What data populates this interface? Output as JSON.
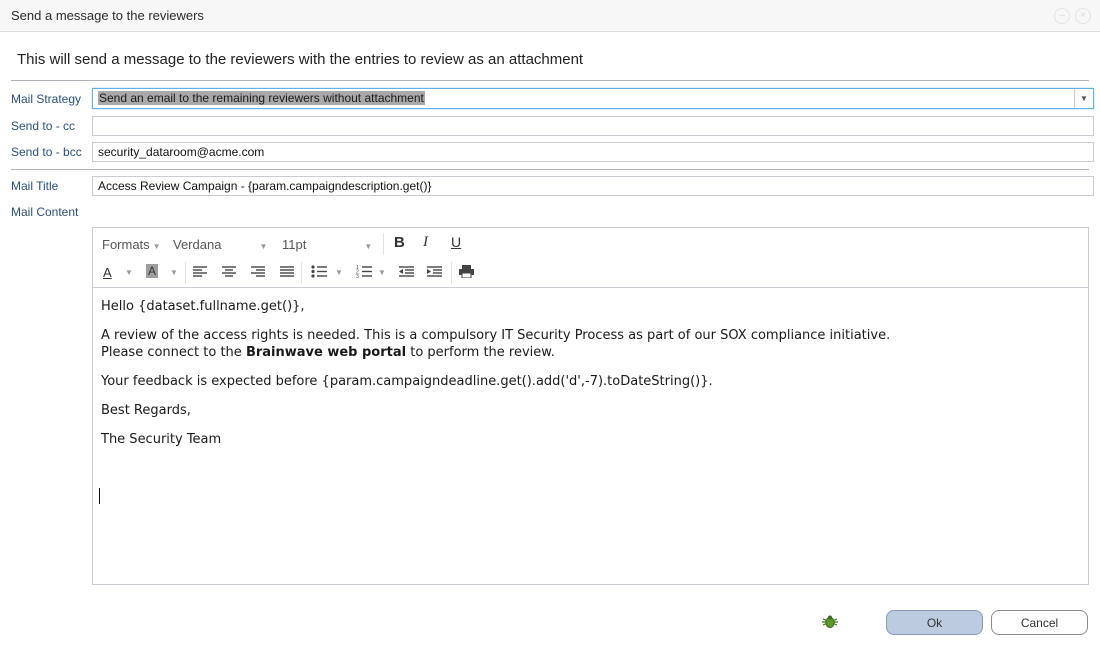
{
  "dialog": {
    "title": "Send a message to the reviewers"
  },
  "intro": "This will send a message to the reviewers with the entries to review as an attachment",
  "form": {
    "mail_strategy": {
      "label": "Mail Strategy",
      "value": "Send an email to the remaining reviewers without attachment"
    },
    "send_cc": {
      "label": "Send to - cc",
      "value": ""
    },
    "send_bcc": {
      "label": "Send to - bcc",
      "value": "security_dataroom@acme.com"
    },
    "mail_title": {
      "label": "Mail Title",
      "value": "Access Review Campaign - {param.campaigndescription.get()}"
    },
    "mail_content": {
      "label": "Mail Content"
    }
  },
  "editor": {
    "toolbar": {
      "formats": "Formats",
      "font": "Verdana",
      "size": "11pt",
      "bold_icon": "bold-icon",
      "italic_icon": "italic-icon",
      "underline_icon": "underline-icon"
    },
    "body": {
      "greeting": "Hello {dataset.fullname.get()},",
      "line1": "A review of the access rights is needed. This is a compulsory IT Security Process as part of our SOX compliance initiative.",
      "line2_pre": "Please connect to the ",
      "line2_bold": "Brainwave web portal",
      "line2_post": " to perform the review.",
      "feedback": "Your feedback is expected before {param.campaigndeadline.get().add('d',-7).toDateString()}.",
      "regards": "Best Regards,",
      "signature": "The Security Team"
    }
  },
  "buttons": {
    "ok": "Ok",
    "cancel": "Cancel"
  },
  "colors": {
    "ok_bg": "#bccbe0",
    "label": "#2c4f7c",
    "select_border": "#61b2e3"
  }
}
